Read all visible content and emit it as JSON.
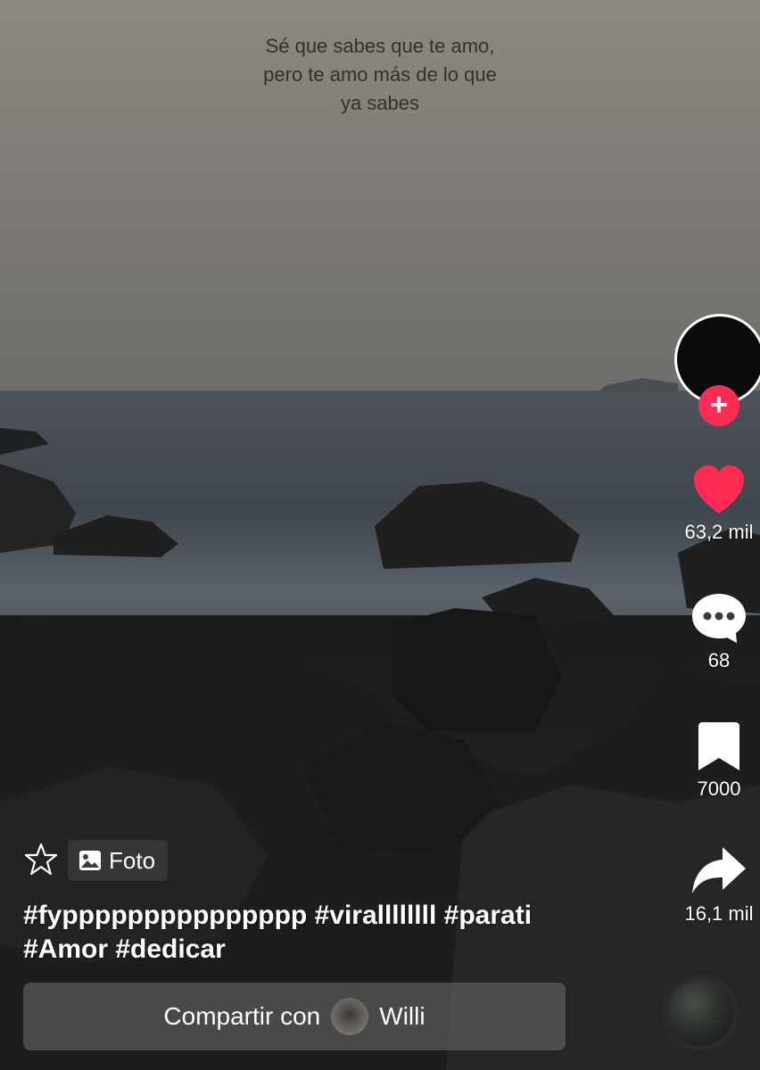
{
  "post": {
    "overlay_text_line1": "Sé que sabes que te amo,",
    "overlay_text_line2": "pero te amo más de lo que",
    "overlay_text_line3": "ya sabes",
    "media_type_label": "Foto",
    "hashtags_line1": "#fyppppppppppppppp #virallllllll #parati",
    "hashtags_line2": "#Amor #dedicar"
  },
  "sidebar": {
    "follow_icon": "plus-icon",
    "likes": "63,2 mil",
    "comments": "68",
    "saves": "7000",
    "shares": "16,1 mil"
  },
  "share_bar": {
    "label": "Compartir con",
    "recipient": "Willi"
  },
  "colors": {
    "accent": "#fe2c55",
    "like": "#fe2c55",
    "text": "#ffffff"
  }
}
